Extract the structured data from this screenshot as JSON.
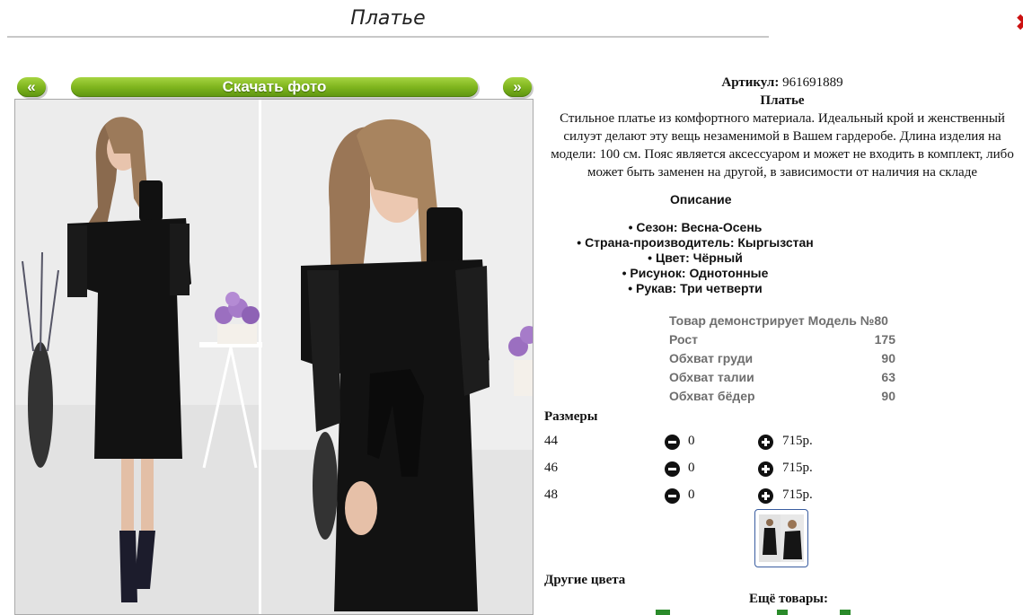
{
  "page": {
    "title": "Платье",
    "close_glyph": "✖"
  },
  "gallery": {
    "prev_label": "«",
    "next_label": "»",
    "download_label": "Скачать фото"
  },
  "product": {
    "sku_label": "Артикул:",
    "sku_value": "961691889",
    "name": "Платье",
    "description": "Стильное платье из комфортного материала. Идеальный крой и женственный силуэт делают эту вещь незаменимой в Вашем гардеробе. Длина изделия на модели: 100 см. Пояс является аксессуаром и может не входить в комплект, либо может быть заменен на другой, в зависимости от наличия на складе"
  },
  "specs": {
    "title": "Описание",
    "items": [
      "• Сезон: Весна-Осень",
      "• Страна-производитель: Кыргызстан",
      "• Цвет: Чёрный",
      "• Рисунок: Однотонные",
      "• Рукав: Три четверти"
    ]
  },
  "model": {
    "header": "Товар демонстрирует Модель №80",
    "rows": [
      {
        "label": "Рост",
        "value": "175"
      },
      {
        "label": "Обхват груди",
        "value": "90"
      },
      {
        "label": "Обхват талии",
        "value": "63"
      },
      {
        "label": "Обхват бёдер",
        "value": "90"
      }
    ]
  },
  "sizes": {
    "title": "Размеры",
    "rows": [
      {
        "size": "44",
        "qty": "0",
        "price": "715р."
      },
      {
        "size": "46",
        "qty": "0",
        "price": "715р."
      },
      {
        "size": "48",
        "qty": "0",
        "price": "715р."
      }
    ]
  },
  "other_colors_label": "Другие цвета",
  "more_goods_label": "Ещё товары:",
  "colors": {
    "button_green": "#7fb51e",
    "thumb_border": "#3a5da0",
    "model_text": "#6e6e6e"
  }
}
